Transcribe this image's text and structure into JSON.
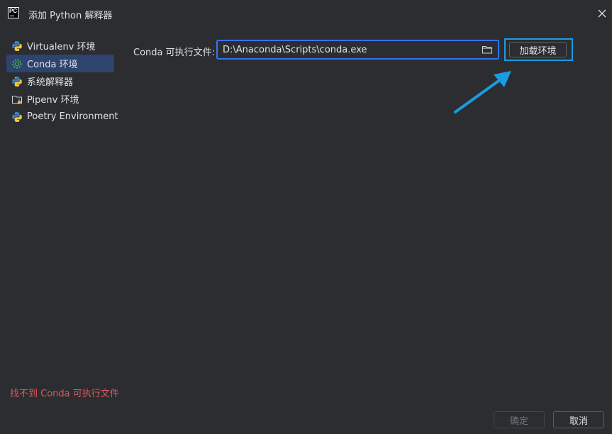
{
  "window": {
    "title": "添加 Python 解释器",
    "logo_text": "PC",
    "icons": {
      "logo": "pycharm-logo-icon",
      "close": "close-icon"
    }
  },
  "sidebar": {
    "items": [
      {
        "label": "Virtualenv 环境",
        "icon": "python-icon",
        "selected": false
      },
      {
        "label": "Conda 环境",
        "icon": "conda-icon",
        "selected": true
      },
      {
        "label": "系统解释器",
        "icon": "python-icon",
        "selected": false
      },
      {
        "label": "Pipenv 环境",
        "icon": "pipenv-folder-icon",
        "selected": false
      },
      {
        "label": "Poetry Environment",
        "icon": "python-icon",
        "selected": false
      }
    ]
  },
  "main": {
    "conda_label": "Conda 可执行文件:",
    "conda_path": "D:\\Anaconda\\Scripts\\conda.exe",
    "browse_icon": "folder-icon",
    "load_button": "加载环境"
  },
  "annotation": {
    "arrow_icon": "pointer-arrow-icon",
    "color": "#1a9ce3"
  },
  "status": {
    "error": "找不到 Conda 可执行文件",
    "error_color": "#e0585b"
  },
  "footer": {
    "ok_label": "确定",
    "ok_enabled": false,
    "cancel_label": "取消"
  },
  "colors": {
    "background": "#2b2d30",
    "accent": "#3574f0",
    "selection": "#2e436e"
  }
}
